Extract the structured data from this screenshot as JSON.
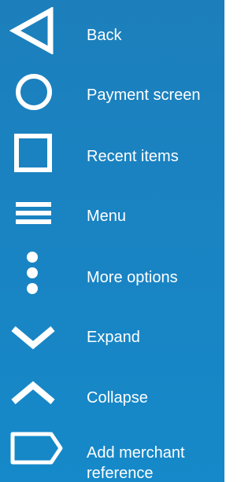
{
  "legend": {
    "items": [
      {
        "icon": "back-triangle-icon",
        "label": "Back"
      },
      {
        "icon": "payment-screen-circle-icon",
        "label": "Payment screen"
      },
      {
        "icon": "recent-items-square-icon",
        "label": "Recent items"
      },
      {
        "icon": "menu-icon",
        "label": "Menu"
      },
      {
        "icon": "more-options-icon",
        "label": "More options"
      },
      {
        "icon": "expand-chevron-down-icon",
        "label": "Expand"
      },
      {
        "icon": "collapse-chevron-up-icon",
        "label": "Collapse"
      },
      {
        "icon": "add-merchant-reference-tag-icon",
        "label": "Add merchant reference"
      }
    ]
  },
  "colors": {
    "background_top": "#1c7fbc",
    "background_bottom": "#1589c9",
    "foreground": "#ffffff"
  }
}
